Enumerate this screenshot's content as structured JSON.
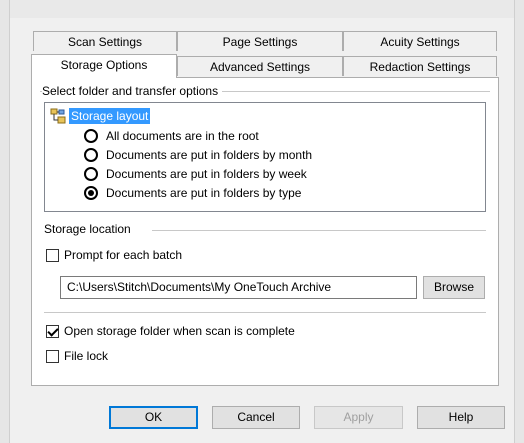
{
  "tabs_row1": [
    {
      "label": "Scan Settings"
    },
    {
      "label": "Page Settings"
    },
    {
      "label": "Acuity Settings"
    }
  ],
  "tabs_row2": [
    {
      "label": "Storage Options",
      "active": true
    },
    {
      "label": "Advanced Settings"
    },
    {
      "label": "Redaction Settings"
    }
  ],
  "group_title": "Select folder and transfer options",
  "tree": {
    "root_label": "Storage layout",
    "root_icon": "folder-tree-icon",
    "options": [
      {
        "label": "All documents are in the root",
        "checked": false
      },
      {
        "label": "Documents are put in folders by month",
        "checked": false
      },
      {
        "label": "Documents are put in folders by week",
        "checked": false
      },
      {
        "label": "Documents are put in folders by type",
        "checked": true
      }
    ]
  },
  "storage_location": {
    "title": "Storage location",
    "prompt_label": "Prompt for each batch",
    "prompt_checked": false,
    "path": "C:\\Users\\Stitch\\Documents\\My OneTouch Archive",
    "browse_label": "Browse"
  },
  "open_folder": {
    "label": "Open storage folder when scan is complete",
    "checked": true
  },
  "file_lock": {
    "label": "File lock",
    "checked": false
  },
  "buttons": {
    "ok": "OK",
    "cancel": "Cancel",
    "apply": "Apply",
    "help": "Help"
  },
  "colors": {
    "selection": "#3399ff",
    "default_button_border": "#0078d7"
  }
}
